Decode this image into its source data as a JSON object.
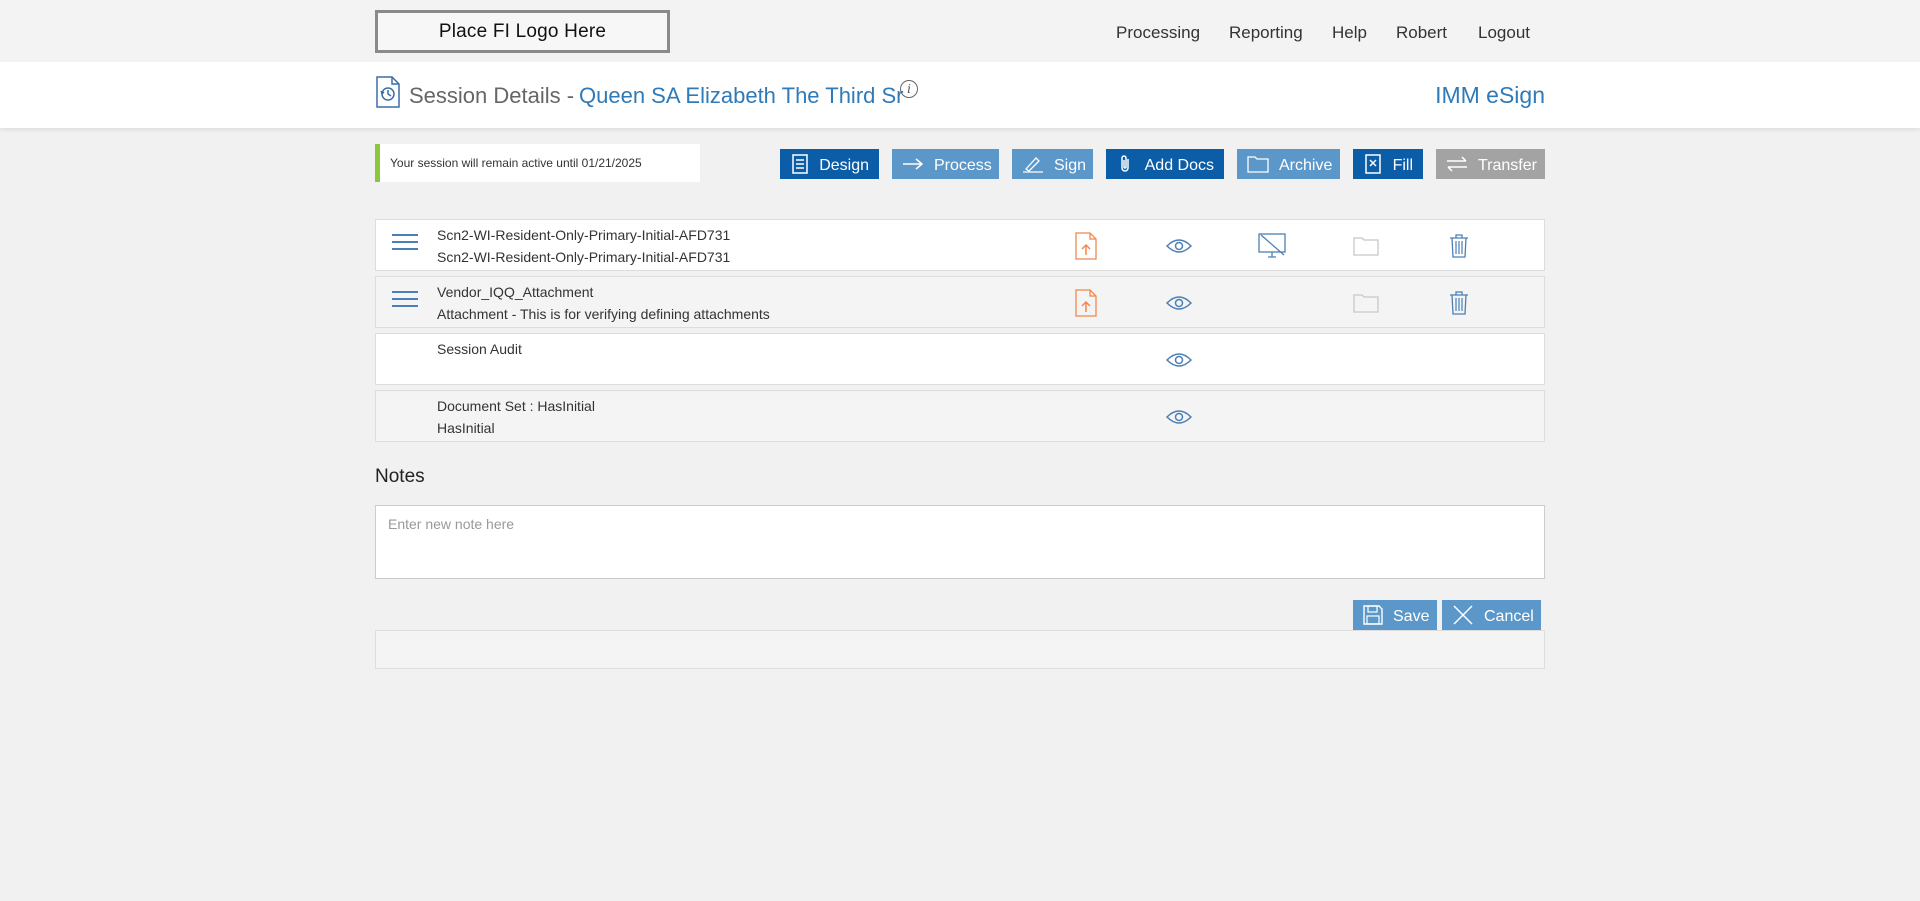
{
  "logo_text": "Place FI Logo Here",
  "nav": {
    "processing": "Processing",
    "reporting": "Reporting",
    "help": "Help",
    "user": "Robert",
    "logout": "Logout"
  },
  "header": {
    "title": "Session Details -",
    "session_name": "Queen SA Elizabeth The Third Sr",
    "brand": "IMM eSign"
  },
  "notice": "Your session will remain active until 01/21/2025",
  "toolbar": {
    "design": "Design",
    "process": "Process",
    "sign": "Sign",
    "add_docs": "Add Docs",
    "archive": "Archive",
    "fill": "Fill",
    "transfer": "Transfer"
  },
  "documents": [
    {
      "line1": "Scn2-WI-Resident-Only-Primary-Initial-AFD731",
      "line2": "Scn2-WI-Resident-Only-Primary-Initial-AFD731"
    },
    {
      "line1": "Vendor_IQQ_Attachment",
      "line2": "Attachment - This is for verifying defining attachments"
    },
    {
      "line1": "Session Audit",
      "line2": ""
    },
    {
      "line1": "Document Set : HasInitial",
      "line2": "HasInitial"
    }
  ],
  "notes": {
    "title": "Notes",
    "placeholder": "Enter new note here",
    "value": ""
  },
  "actions": {
    "save": "Save",
    "cancel": "Cancel"
  },
  "colors": {
    "primary_dark": "#0c5da8",
    "primary_light": "#5b97c9",
    "disabled": "#a3a3a3",
    "accent_green": "#8cc63f",
    "upload_orange": "#f0884a"
  }
}
